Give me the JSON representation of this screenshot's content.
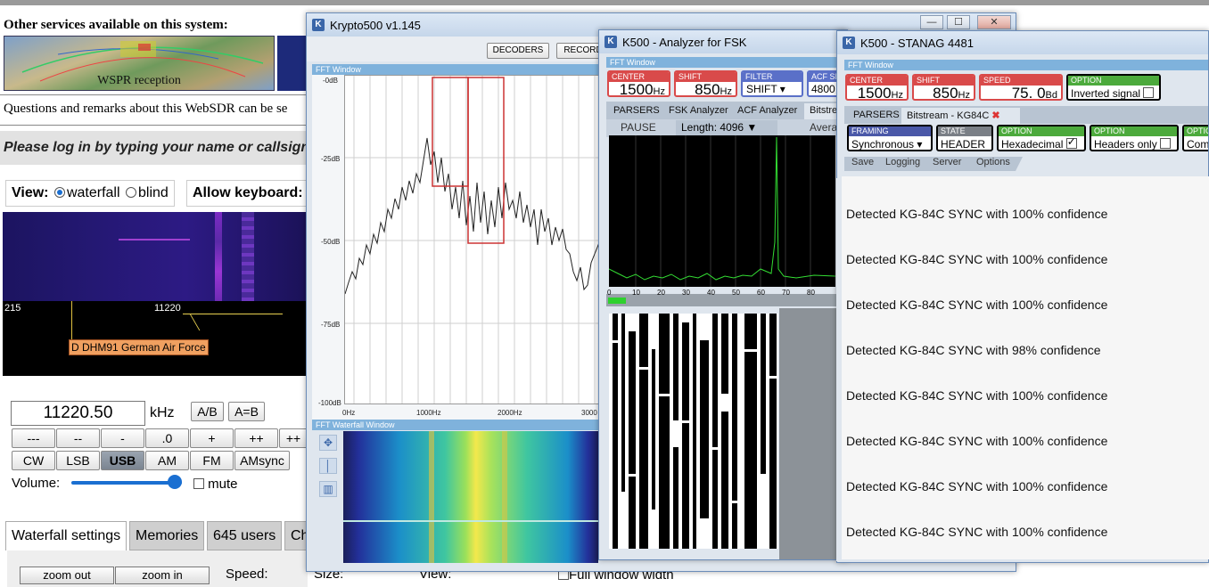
{
  "websdr": {
    "services_heading": "Other services available on this system:",
    "wspr_label": "WSPR reception",
    "questions_text": "Questions and remarks about this WebSDR can be se",
    "login_text": "Please log in by typing your name or callsign",
    "view_label": "View:",
    "view_waterfall": "waterfall",
    "view_blind": "blind",
    "allow_keyboard": "Allow keyboard:",
    "scale_left": "215",
    "scale_mid": "11220",
    "station_label": "D DHM91 German Air Force",
    "frequency": "11220.50",
    "unit": "kHz",
    "ab_button": "A/B",
    "aeqb_button": "A=B",
    "step_buttons": [
      "---",
      "--",
      "-",
      ".0",
      "+",
      "++",
      "++"
    ],
    "mode_buttons": [
      "CW",
      "LSB",
      "USB",
      "AM",
      "FM",
      "AMsync"
    ],
    "selected_mode": "USB",
    "volume_label": "Volume:",
    "mute_label": "mute",
    "tabs": [
      "Waterfall settings",
      "Memories",
      "645 users",
      "Ch"
    ],
    "zoom_out": "zoom out",
    "zoom_in": "zoom in",
    "speed_label": "Speed:",
    "size_label": "Size:",
    "view2_label": "View:",
    "full_window": "Full window width"
  },
  "krypto": {
    "title": "Krypto500 v1.145",
    "decoders_button": "DECODERS",
    "record_button": "RECORD",
    "fft_window_label": "FFT Window",
    "y_ticks": [
      "-0dB",
      "-25dB",
      "-50dB",
      "-75dB",
      "-100dB"
    ],
    "x_ticks": [
      "0Hz",
      "1000Hz",
      "2000Hz",
      "3000"
    ],
    "waterfall_label": "FFT Waterfall Window"
  },
  "analyzer": {
    "title": "K500 - Analyzer for FSK",
    "fft_window_label": "FFT Window",
    "center_label": "CENTER",
    "center_value": "1500",
    "center_unit": "Hz",
    "shift_label": "SHIFT",
    "shift_value": "850",
    "shift_unit": "Hz",
    "filter_label": "FILTER",
    "filter_value": "SHIFT",
    "acf_label": "ACF SI",
    "acf_value": "4800",
    "tabs": [
      "PARSERS",
      "FSK Analyzer",
      "ACF Analyzer",
      "Bitstre"
    ],
    "pause_label": "PAUSE",
    "length_label": "Length:",
    "length_value": "4096 ▼",
    "average_label": "Averag",
    "scope_x_ticks": [
      "0",
      "10",
      "20",
      "30",
      "40",
      "50",
      "60",
      "70",
      "80"
    ]
  },
  "stanag": {
    "title": "K500 - STANAG 4481",
    "fft_window_label": "FFT Window",
    "center_label": "CENTER",
    "center_value": "1500",
    "center_unit": "Hz",
    "shift_label": "SHIFT",
    "shift_value": "850",
    "shift_unit": "Hz",
    "speed_label": "SPEED",
    "speed_value": "75. 0",
    "speed_unit": "Bd",
    "option_label": "OPTION",
    "inverted_label": "Inverted signal",
    "tabs": [
      "PARSERS",
      "Bitstream - KG84C"
    ],
    "framing_label": "FRAMING",
    "framing_value": "Synchronous",
    "state_label": "STATE",
    "state_value": "HEADER",
    "opt1_label": "OPTION",
    "opt1_value": "Hexadecimal",
    "opt2_label": "OPTION",
    "opt2_value": "Headers only",
    "opt3_label": "OPTIO",
    "opt3_value": "Com",
    "menu": [
      "Save",
      "Logging",
      "Server",
      "Options"
    ],
    "log": [
      "Detected KG-84C SYNC with 100% confidence",
      "Detected KG-84C SYNC with 100% confidence",
      "Detected KG-84C SYNC with 100% confidence",
      "Detected KG-84C SYNC with 98% confidence",
      "Detected KG-84C SYNC with 100% confidence",
      "Detected KG-84C SYNC with 100% confidence",
      "Detected KG-84C SYNC with 100% confidence",
      "Detected KG-84C SYNC with 100% confidence"
    ]
  },
  "colors": {
    "accent_blue": "#1a6fd1",
    "param_red": "#d94a4a",
    "param_blue": "#5a70c8",
    "param_green": "#4caa3c",
    "scope_trace": "#33dd33"
  }
}
